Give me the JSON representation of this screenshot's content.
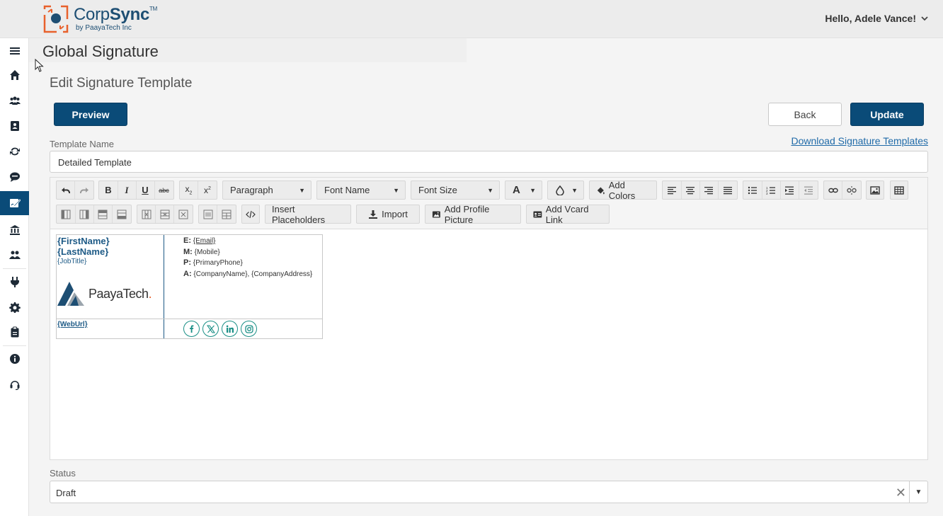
{
  "header": {
    "brand_prefix": "Corp",
    "brand_suffix": "Sync",
    "brand_tm": "TM",
    "brand_sub": "by PaayaTech Inc",
    "greeting": "Hello, Adele Vance!"
  },
  "page": {
    "title": "Global Signature",
    "section_title": "Edit Signature Template"
  },
  "actions": {
    "preview": "Preview",
    "back": "Back",
    "update": "Update"
  },
  "form": {
    "template_name_label": "Template Name",
    "download_link": "Download Signature Templates",
    "template_name_value": "Detailed Template",
    "status_label": "Status",
    "status_value": "Draft"
  },
  "toolbar": {
    "paragraph": "Paragraph",
    "font_name": "Font Name",
    "font_size": "Font Size",
    "font_color_glyph": "A",
    "add_colors": "Add Colors",
    "insert_placeholders": "Insert Placeholders",
    "import": "Import",
    "add_profile_picture": "Add Profile Picture",
    "add_vcard_link": "Add Vcard Link"
  },
  "signature": {
    "first_name": "{FirstName}",
    "last_name": "{LastName}",
    "job_title": "{JobTitle}",
    "logo_text": "PaayaTech",
    "logo_dot": ".",
    "web_url": "{WebUrl}",
    "email_label": "E:",
    "email_value": "{Email}",
    "mobile_label": "M:",
    "mobile_value": "{Mobile}",
    "phone_label": "P:",
    "phone_value": "{PrimaryPhone}",
    "address_label": "A:",
    "company_name": "{CompanyName}",
    "address_sep": ", ",
    "company_address": "{CompanyAddress}"
  },
  "colors": {
    "primary": "#0a4b78",
    "link": "#1f6aa8",
    "social": "#1a8f86",
    "logo_orange": "#e8612c"
  },
  "icons": {
    "sidebar": [
      "menu-icon",
      "home-icon",
      "users-icon",
      "contact-book-icon",
      "sync-icon",
      "sms-icon",
      "signature-icon",
      "bank-icon",
      "group-icon",
      "plug-icon",
      "gear-icon",
      "clipboard-icon",
      "info-icon",
      "headset-icon"
    ]
  }
}
